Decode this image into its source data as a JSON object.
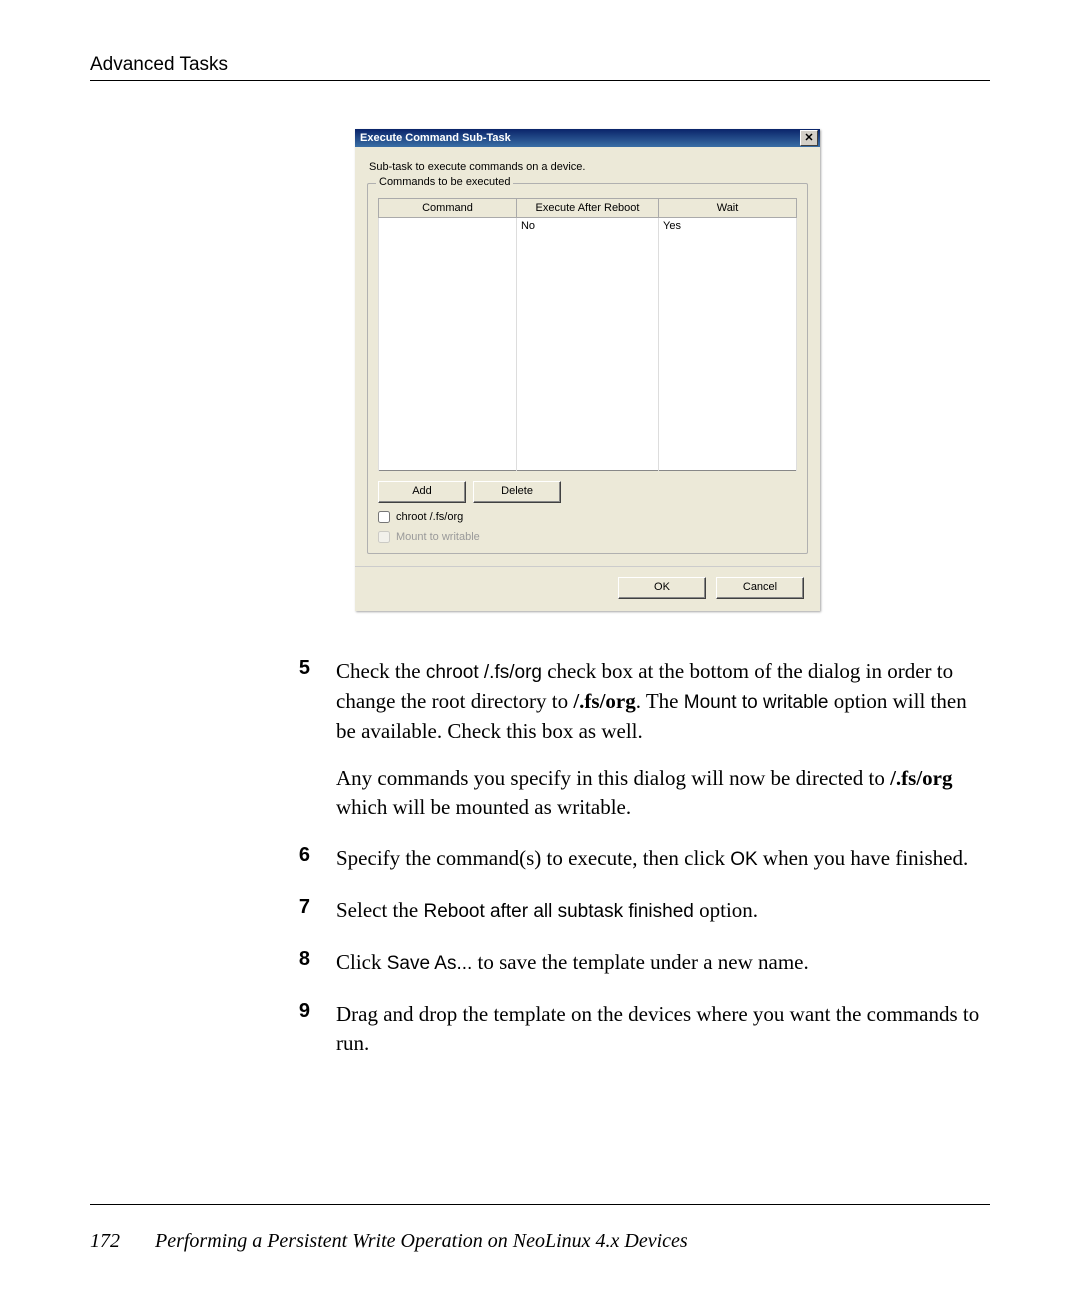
{
  "runningHead": "Advanced Tasks",
  "dialog": {
    "title": "Execute Command Sub-Task",
    "closeGlyph": "✕",
    "description": "Sub-task to execute commands on a device.",
    "groupLegend": "Commands to be executed",
    "columns": {
      "c1": "Command",
      "c2": "Execute After Reboot",
      "c3": "Wait"
    },
    "row": {
      "command": "",
      "reboot": "No",
      "wait": "Yes"
    },
    "buttons": {
      "add": "Add",
      "delete": "Delete",
      "ok": "OK",
      "cancel": "Cancel"
    },
    "check1": "chroot /.fs/org",
    "check2": "Mount to writable"
  },
  "steps": {
    "s5": {
      "num": "5",
      "p1a": "Check the ",
      "code1": "chroot /.fs/org",
      "p1b": " check box at the bottom of the dialog in order to change the root directory to ",
      "bold1": "/.fs/org",
      "p1c": ". The ",
      "code2": "Mount to writable",
      "p1d": " option will then be available. Check this box as well.",
      "p2a": "Any commands you specify in this dialog will now be directed to ",
      "bold2": "/.fs/org",
      "p2b": " which will be mounted as writable."
    },
    "s6": {
      "num": "6",
      "a": "Specify the command(s) to execute, then click ",
      "code": "OK",
      "b": " when you have finished."
    },
    "s7": {
      "num": "7",
      "a": "Select the ",
      "code": "Reboot after all subtask finished",
      "b": " option."
    },
    "s8": {
      "num": "8",
      "a": "Click ",
      "code": "Save As...",
      "b": " to save the template under a new name."
    },
    "s9": {
      "num": "9",
      "a": "Drag and drop the template on the devices where you want the commands to run."
    }
  },
  "footer": {
    "pageNum": "172",
    "title": "Performing a Persistent Write Operation on NeoLinux 4.x Devices"
  }
}
